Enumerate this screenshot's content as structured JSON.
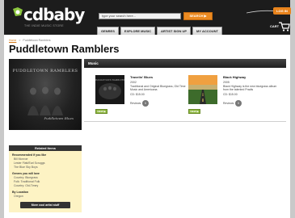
{
  "brand": {
    "name": "cdbaby",
    "tagline": "THE INDIE MUSIC STORE"
  },
  "search": {
    "placeholder": "type your search here...",
    "button_label": "SEARCH ▶"
  },
  "nav": {
    "tabs": [
      "GENRES",
      "EXPLORE MUSIC",
      "ARTIST SIGN UP",
      "MY ACCOUNT"
    ]
  },
  "account": {
    "login_label": "LOG IN",
    "cart_label": "CART"
  },
  "breadcrumb": {
    "home": "Home",
    "separator": ">",
    "current": "Puddletown Ramblers"
  },
  "page": {
    "title": "Puddletown Ramblers",
    "photo_title": "PUDDLETOWN RAMBLERS",
    "photo_signature": "Puddletown Blues"
  },
  "music": {
    "header": "Music",
    "albums": [
      {
        "title": "Travelin' Blues",
        "year": "2002",
        "description": "Traditional and Original Bluegrass, Old Time Music and Americana",
        "price": "CD: $15.00",
        "reviews_label": "Reviews",
        "reviews_count": "0",
        "view_label": "VIEW ▶"
      },
      {
        "title": "Black Highway",
        "year": "2005",
        "description": "Black Highway is the new bluegrass album from the talented Pradis",
        "price": "CD: $15.00",
        "reviews_label": "Reviews",
        "reviews_count": "0",
        "view_label": "VIEW ▶"
      }
    ]
  },
  "sidebar": {
    "header": "Related Items",
    "sections": [
      {
        "title": "Recommended if you like",
        "links": [
          "Bill Monroe",
          "Lester Flatt/Earl Scruggs",
          "The Blue Sky Boys"
        ]
      },
      {
        "title": "Genres you will love",
        "links": [
          "Country: Bluegrass",
          "Folk: Traditional Folk",
          "Country: Old-Timey"
        ]
      },
      {
        "title": "By Location",
        "links": [
          "Oregon"
        ]
      }
    ],
    "more_button": "More cool artist stuff"
  },
  "colors": {
    "header_bg": "#1c1c1c",
    "accent_orange": "#eb8a21",
    "view_green": "#8cb63d",
    "sidebar_bg": "#fdf3c4"
  }
}
